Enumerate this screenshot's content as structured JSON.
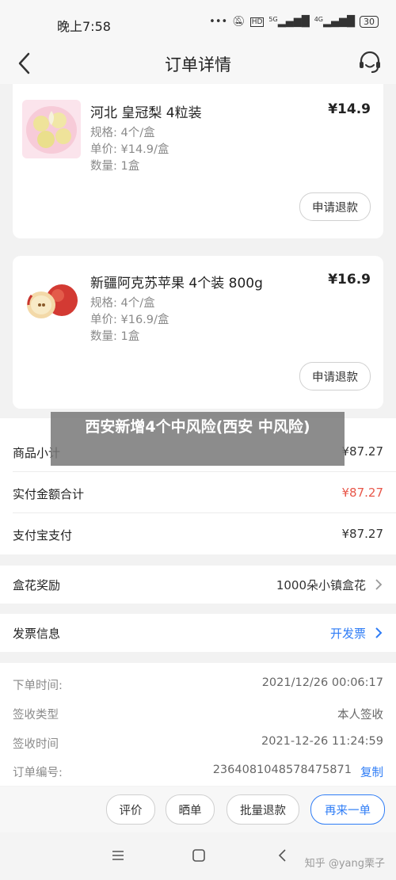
{
  "status_bar": {
    "time": "晚上7:58",
    "network_1": "HD",
    "network_2": "5G",
    "network_3": "4G",
    "battery": "30"
  },
  "header": {
    "title": "订单详情"
  },
  "products": [
    {
      "name": "河北 皇冠梨 4粒装",
      "price": "¥14.9",
      "spec": "规格: 4个/盒",
      "unit_price": "单价: ¥14.9/盒",
      "quantity": "数量: 1盒",
      "refund_label": "申请退款"
    },
    {
      "name": "新疆阿克苏苹果 4个装 800g",
      "price": "¥16.9",
      "spec": "规格: 4个/盒",
      "unit_price": "单价: ¥16.9/盒",
      "quantity": "数量: 1盒",
      "refund_label": "申请退款"
    }
  ],
  "overlay_text": "西安新增4个中风险(西安 中风险)",
  "summary": {
    "subtotal_label": "商品小计",
    "subtotal_value": "¥87.27",
    "paid_label": "实付金额合计",
    "paid_value": "¥87.27",
    "alipay_label": "支付宝支付",
    "alipay_value": "¥87.27"
  },
  "reward": {
    "label": "盒花奖励",
    "value": "1000朵小镇盒花"
  },
  "invoice": {
    "label": "发票信息",
    "action": "开发票"
  },
  "order_info": {
    "order_time_label": "下单时间:",
    "order_time_value": "2021/12/26 00:06:17",
    "receipt_type_label": "签收类型",
    "receipt_type_value": "本人签收",
    "receipt_time_label": "签收时间",
    "receipt_time_value": "2021-12-26 11:24:59",
    "order_no_label": "订单编号:",
    "order_no_value": "2364081048578475871",
    "copy_label": "复制"
  },
  "actions": {
    "review": "评价",
    "share": "晒单",
    "batch_refund": "批量退款",
    "reorder": "再来一单"
  },
  "watermark": "知乎 @yang栗子",
  "colors": {
    "accent_blue": "#2f7df6",
    "paid_red": "#e8574a"
  }
}
